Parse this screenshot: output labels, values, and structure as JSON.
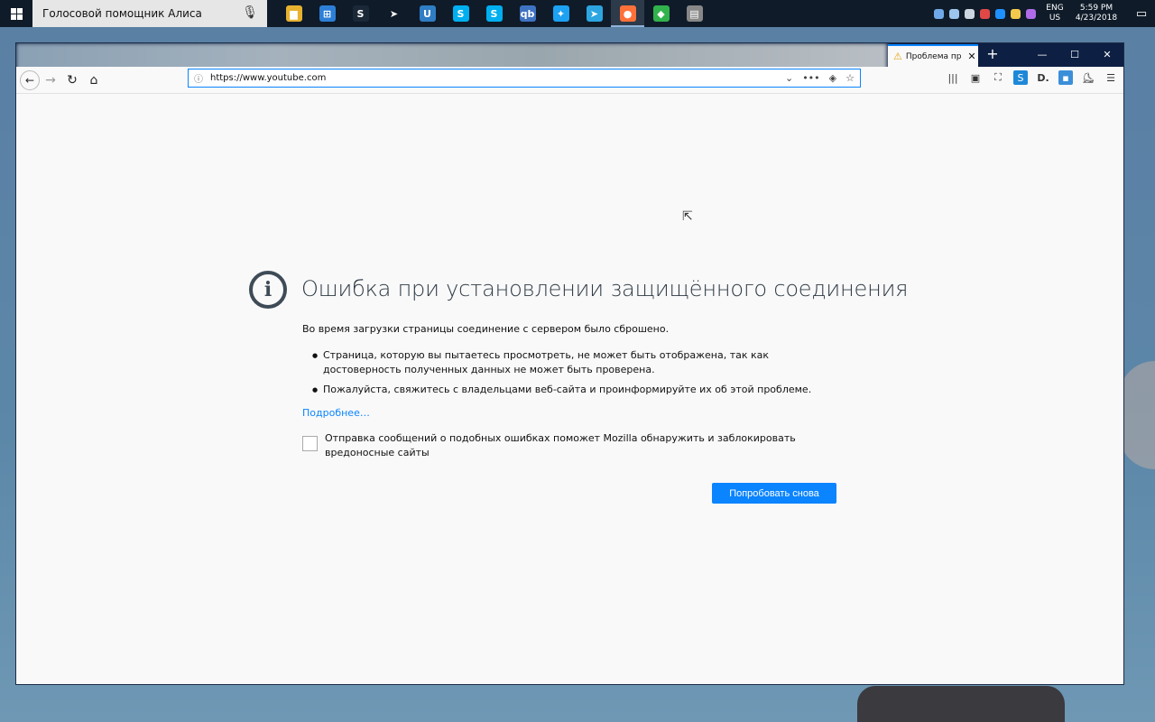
{
  "taskbar": {
    "assistant_label": "Голосовой помощник Алиса",
    "apps": [
      {
        "name": "file-explorer-icon",
        "glyph": "▆",
        "color": "#e8b230"
      },
      {
        "name": "store-icon",
        "glyph": "⊞",
        "color": "#2d7fd6"
      },
      {
        "name": "steam-icon",
        "glyph": "S",
        "color": "#1b2838"
      },
      {
        "name": "telegram-icon",
        "glyph": "➤",
        "color": "#0f1b29"
      },
      {
        "name": "uplay-icon",
        "glyph": "U",
        "color": "#2f7dc4"
      },
      {
        "name": "skype-icon",
        "glyph": "S",
        "color": "#00aff0"
      },
      {
        "name": "skype-icon-2",
        "glyph": "S",
        "color": "#00aff0"
      },
      {
        "name": "qbittorrent-icon",
        "glyph": "qb",
        "color": "#3f73c2"
      },
      {
        "name": "twitter-icon",
        "glyph": "✦",
        "color": "#1da1f2"
      },
      {
        "name": "telegram-icon-2",
        "glyph": "➤",
        "color": "#2ca5e0"
      },
      {
        "name": "firefox-icon",
        "glyph": "●",
        "color": "#ff7139"
      },
      {
        "name": "vpn-icon",
        "glyph": "◆",
        "color": "#31b24c"
      },
      {
        "name": "apps-icon",
        "glyph": "▤",
        "color": "#888888"
      }
    ],
    "active_app_index": 10,
    "tray_colors": [
      "#6fa9e8",
      "#9cc6ee",
      "#ccd6e0",
      "#e04848",
      "#1e90ff",
      "#f2c94c",
      "#b06be8"
    ],
    "lang_line1": "ENG",
    "lang_line2": "US",
    "time": "5:59 PM",
    "date": "4/23/2018"
  },
  "browser": {
    "tab_title": "Проблема пр",
    "url": "https://www.youtube.com"
  },
  "error": {
    "title": "Ошибка при установлении защищённого соединения",
    "description": "Во время загрузки страницы соединение с сервером было сброшено.",
    "bullets": [
      "Страница, которую вы пытаетесь просмотреть, не может быть отображена, так как достоверность полученных данных не может быть проверена.",
      "Пожалуйста, свяжитесь с владельцами веб-сайта и проинформируйте их об этой проблеме."
    ],
    "learn_more": "Подробнее…",
    "report_text": "Отправка сообщений о подобных ошибках поможет Mozilla обнаружить и заблокировать вредоносные сайты",
    "retry_label": "Попробовать снова"
  }
}
